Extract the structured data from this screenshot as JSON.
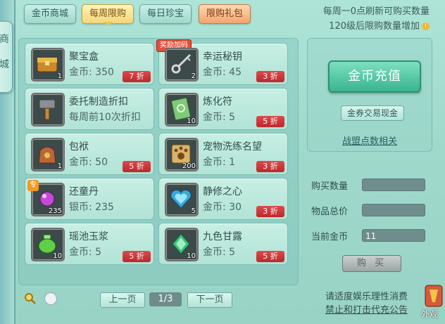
{
  "side_tab": {
    "chars": [
      "商",
      "城"
    ]
  },
  "tabs": [
    {
      "label": "金币商城"
    },
    {
      "label": "每周限购"
    },
    {
      "label": "每日珍宝"
    },
    {
      "label": "限购礼包"
    }
  ],
  "notice": {
    "line1": "每周一0点刷新可购买数量",
    "line2": "120级后限购数量增加"
  },
  "items": [
    {
      "name": "聚宝盒",
      "price": "金币: 350",
      "discount": "7 折",
      "qty": "1",
      "icon": "treasure-chest-icon"
    },
    {
      "name": "幸运秘钥",
      "price": "金币: 45",
      "discount": "3 折",
      "qty": "2",
      "icon": "key-icon",
      "tag": "奖励加码"
    },
    {
      "name": "委托制造折扣",
      "price": "每周前10次折扣",
      "discount": "",
      "qty": "",
      "icon": "hammer-icon"
    },
    {
      "name": "炼化符",
      "price": "金币: 5",
      "discount": "5 折",
      "qty": "10",
      "icon": "talisman-icon"
    },
    {
      "name": "包袱",
      "price": "金币: 50",
      "discount": "5 折",
      "qty": "1",
      "icon": "bag-icon"
    },
    {
      "name": "宠物洗练名望",
      "price": "金币: 1",
      "discount": "3 折",
      "qty": "200",
      "icon": "paw-scroll-icon"
    },
    {
      "name": "还童丹",
      "price": "银币: 235",
      "discount": "",
      "qty": "235",
      "icon": "pill-icon",
      "tag": "专"
    },
    {
      "name": "静修之心",
      "price": "金币: 30",
      "discount": "3 折",
      "qty": "5",
      "icon": "heart-gem-icon"
    },
    {
      "name": "瑶池玉浆",
      "price": "金币: 5",
      "discount": "5 折",
      "qty": "10",
      "icon": "jade-jar-icon"
    },
    {
      "name": "九色甘露",
      "price": "金币: 5",
      "discount": "5 折",
      "qty": "10",
      "icon": "dew-gem-icon"
    }
  ],
  "panel": {
    "recharge_label": "金币充值",
    "voucher_label": "金券交易现金",
    "alliance_label": "战盟点数相关"
  },
  "form": {
    "qty_label": "购买数量",
    "qty_value": "",
    "total_label": "物品总价",
    "total_value": "",
    "gold_label": "当前金币",
    "gold_value": "11",
    "buy_label": "购 买"
  },
  "pager": {
    "prev": "上一页",
    "current": "1/3",
    "next": "下一页"
  },
  "tips": {
    "line1": "请适度娱乐理性消费",
    "line2": "禁止和打击代充公告"
  },
  "appearance_label": "外观",
  "colors": {
    "discount": "#c0302f",
    "active_tab": "#f2d679",
    "recharge": "#39b48e"
  }
}
